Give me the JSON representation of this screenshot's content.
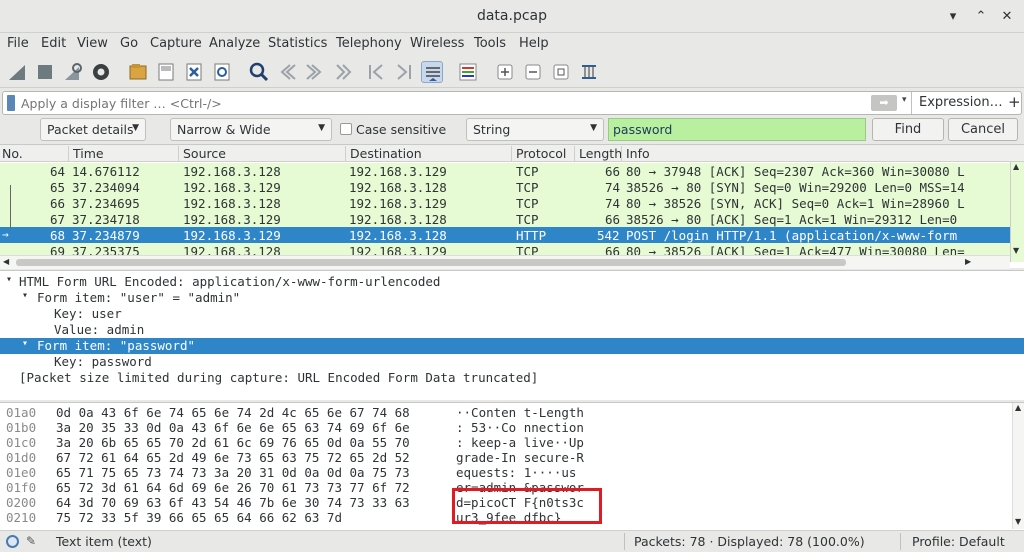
{
  "window": {
    "title": "data.pcap"
  },
  "menu": [
    "File",
    "Edit",
    "View",
    "Go",
    "Capture",
    "Analyze",
    "Statistics",
    "Telephony",
    "Wireless",
    "Tools",
    "Help"
  ],
  "filter": {
    "placeholder": "Apply a display filter … <Ctrl-/>",
    "expression_label": "Expression…",
    "plus": "+"
  },
  "find": {
    "scope": "Packet details",
    "char_width": "Narrow & Wide",
    "case_sensitive_label": "Case sensitive",
    "type": "String",
    "search_value": "password",
    "find_label": "Find",
    "cancel_label": "Cancel"
  },
  "packet_list": {
    "columns": [
      "No.",
      "Time",
      "Source",
      "Destination",
      "Protocol",
      "Length",
      "Info"
    ],
    "rows": [
      {
        "no": "64",
        "time": "14.676112",
        "src": "192.168.3.128",
        "dst": "192.168.3.129",
        "proto": "TCP",
        "len": "66",
        "info": "80 → 37948 [ACK] Seq=2307 Ack=360 Win=30080 L"
      },
      {
        "no": "65",
        "time": "37.234094",
        "src": "192.168.3.129",
        "dst": "192.168.3.128",
        "proto": "TCP",
        "len": "74",
        "info": "38526 → 80 [SYN] Seq=0 Win=29200 Len=0 MSS=14"
      },
      {
        "no": "66",
        "time": "37.234695",
        "src": "192.168.3.128",
        "dst": "192.168.3.129",
        "proto": "TCP",
        "len": "74",
        "info": "80 → 38526 [SYN, ACK] Seq=0 Ack=1 Win=28960 L"
      },
      {
        "no": "67",
        "time": "37.234718",
        "src": "192.168.3.129",
        "dst": "192.168.3.128",
        "proto": "TCP",
        "len": "66",
        "info": "38526 → 80 [ACK] Seq=1 Ack=1 Win=29312 Len=0"
      },
      {
        "no": "68",
        "time": "37.234879",
        "src": "192.168.3.129",
        "dst": "192.168.3.128",
        "proto": "HTTP",
        "len": "542",
        "info": "POST /login HTTP/1.1  (application/x-www-form"
      },
      {
        "no": "69",
        "time": "37.235375",
        "src": "192.168.3.128",
        "dst": "192.168.3.129",
        "proto": "TCP",
        "len": "66",
        "info": "80 → 38526 [ACK] Seq=1 Ack=477 Win=30080 Len="
      }
    ]
  },
  "details": [
    "HTML Form URL Encoded: application/x-www-form-urlencoded",
    "Form item: \"user\" = \"admin\"",
    "Key: user",
    "Value: admin",
    "Form item: \"password\"",
    "Key: password",
    "[Packet size limited during capture: URL Encoded Form Data truncated]"
  ],
  "bytes": [
    {
      "off": "01a0",
      "hex": "0d 0a 43 6f 6e 74 65 6e  74 2d 4c 65 6e 67 74 68",
      "asc": "··Conten t-Length"
    },
    {
      "off": "01b0",
      "hex": "3a 20 35 33 0d 0a 43 6f  6e 6e 65 63 74 69 6f 6e",
      "asc": ": 53··Co nnection"
    },
    {
      "off": "01c0",
      "hex": "3a 20 6b 65 65 70 2d 61  6c 69 76 65 0d 0a 55 70",
      "asc": ": keep-a live··Up"
    },
    {
      "off": "01d0",
      "hex": "67 72 61 64 65 2d 49 6e  73 65 63 75 72 65 2d 52",
      "asc": "grade-In secure-R"
    },
    {
      "off": "01e0",
      "hex": "65 71 75 65 73 74 73 3a  20 31 0d 0a 0d 0a 75 73",
      "asc": "equests:  1····us"
    },
    {
      "off": "01f0",
      "hex": "65 72 3d 61 64 6d 69 6e  26 70 61 73 73 77 6f 72",
      "asc": "er=admin &passwor"
    },
    {
      "off": "0200",
      "hex": "64 3d 70 69 63 6f 43 54  46 7b 6e 30 74 73 33 63",
      "asc": "d=picoCT F{n0ts3c"
    },
    {
      "off": "0210",
      "hex": "75 72 33 5f 39 66 65 65  64 66 62 63 7d",
      "asc": "ur3_9fee dfbc}"
    }
  ],
  "status": {
    "item": "Text item (text)",
    "packets": "Packets: 78 · Displayed: 78 (100.0%)",
    "profile": "Profile: Default"
  }
}
